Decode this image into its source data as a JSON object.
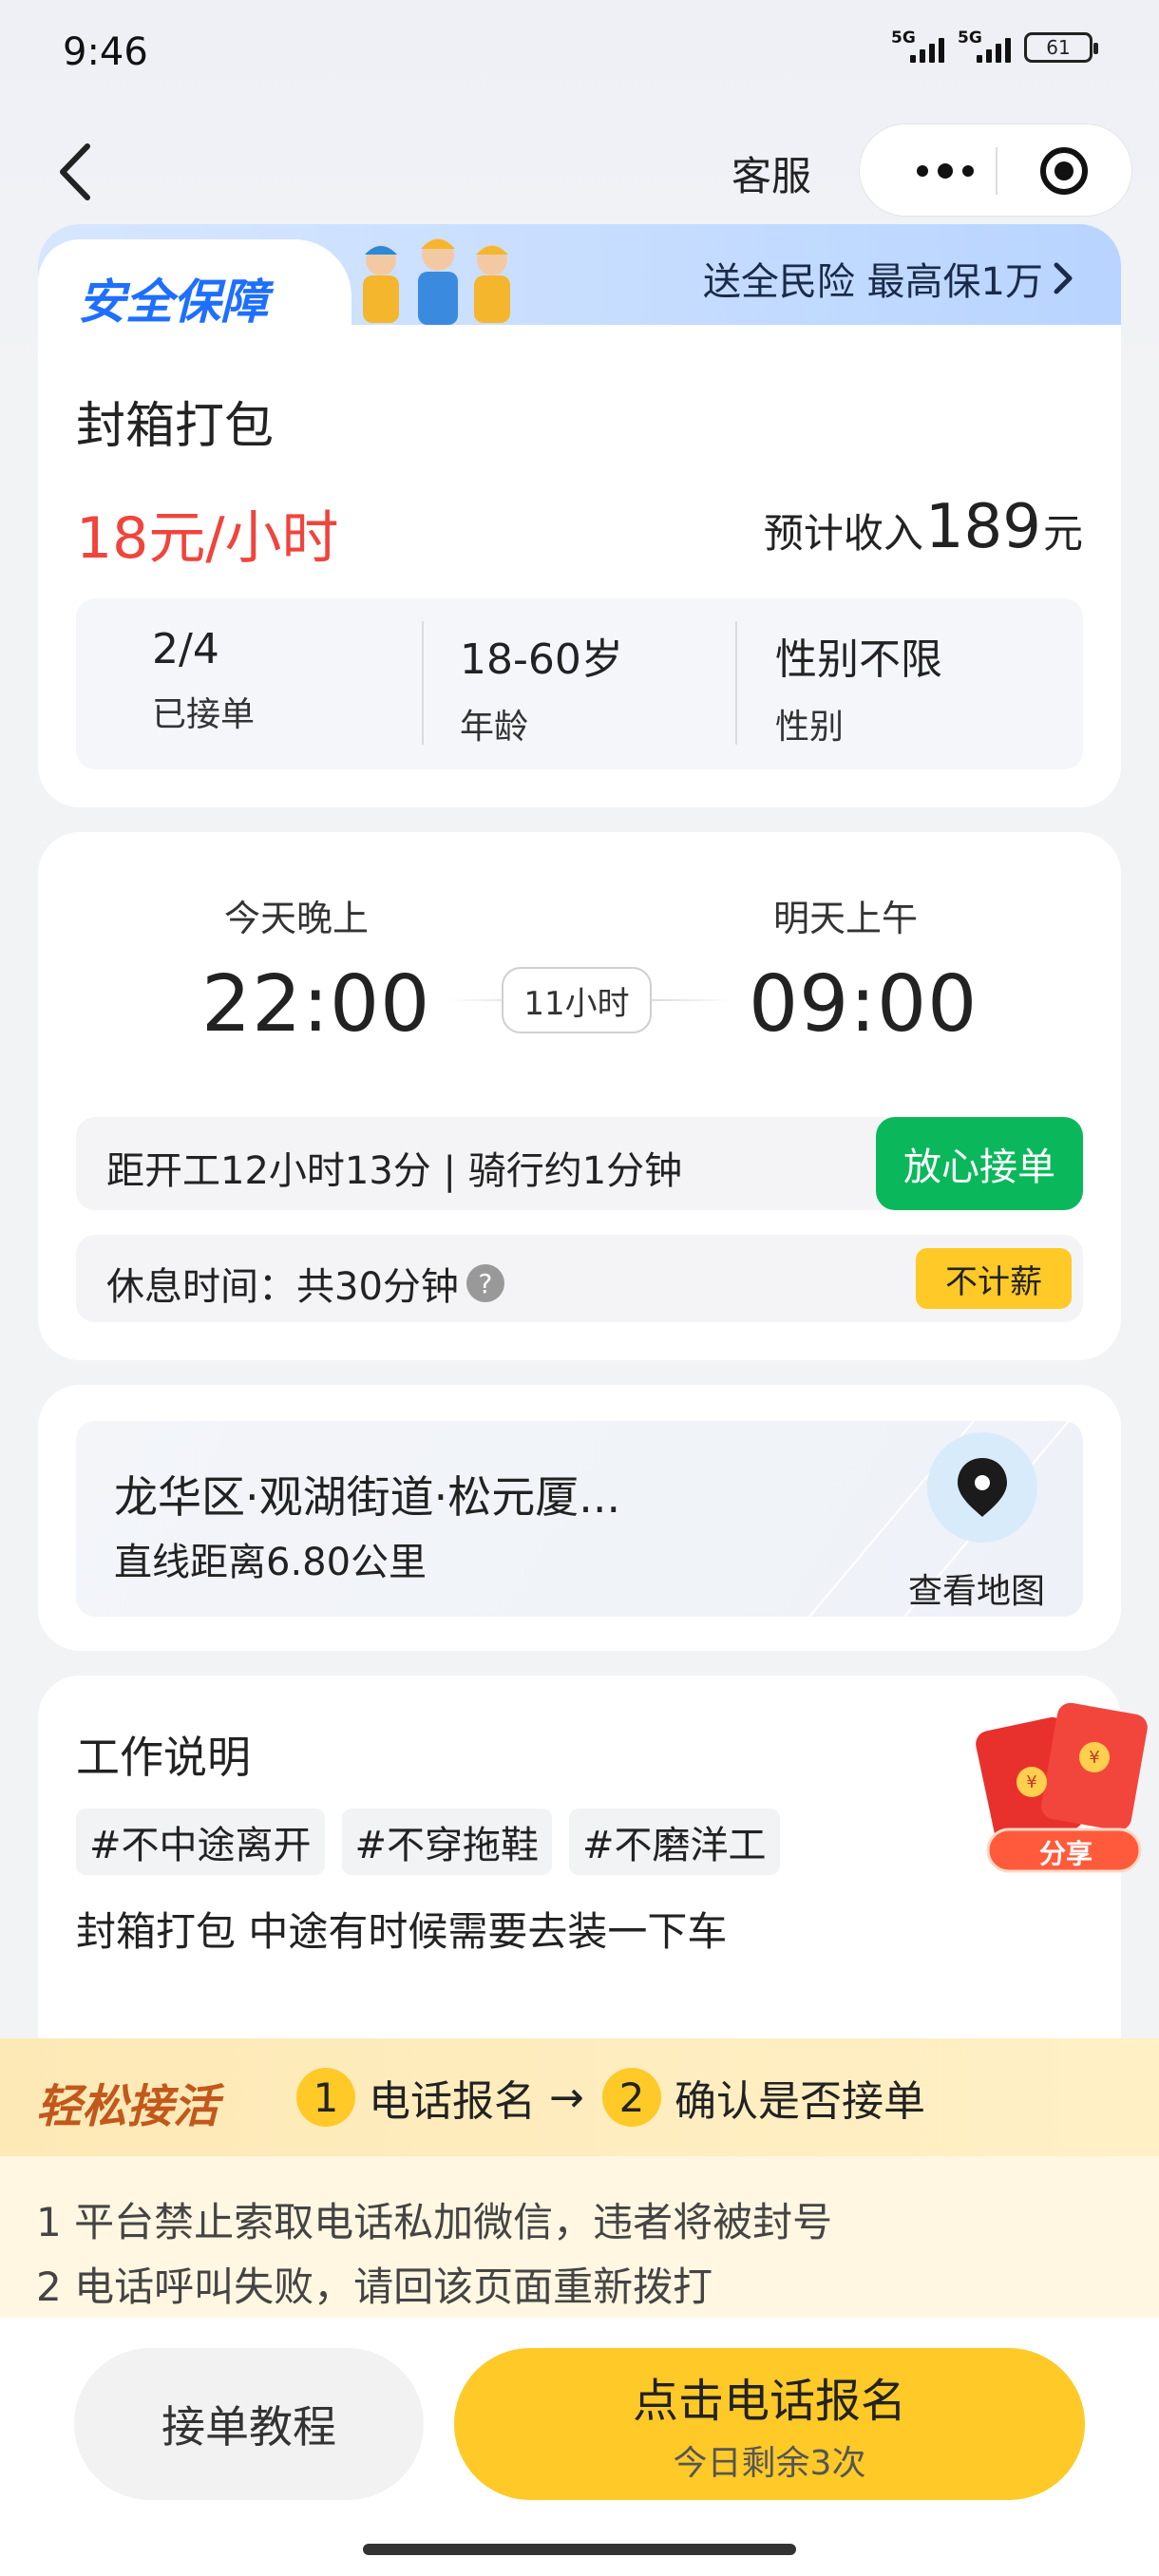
{
  "status_bar": {
    "time": "9:46",
    "signal1": "5G",
    "signal2": "5G",
    "battery": "61"
  },
  "nav": {
    "title": "客服"
  },
  "safety": {
    "title": "安全保障",
    "promo": "送全民险 最高保1万",
    "promo_arrow": "›"
  },
  "job": {
    "title": "封箱打包",
    "wage": "18元/小时",
    "income_prefix": "预计收入",
    "income_value": "189",
    "income_unit": "元",
    "stats": [
      {
        "value": "2/4",
        "label": "已接单"
      },
      {
        "value": "18-60岁",
        "label": "年龄"
      },
      {
        "value": "性别不限",
        "label": "性别"
      }
    ]
  },
  "schedule": {
    "start_label": "今天晚上",
    "start_time": "22:00",
    "duration": "11小时",
    "end_label": "明天上午",
    "end_time": "09:00",
    "distance_text": "距开工12小时13分 | 骑行约1分钟",
    "accept_label": "放心接单",
    "rest_text": "休息时间：共30分钟",
    "help": "?",
    "no_pay": "不计薪"
  },
  "location": {
    "address": "龙华区·观湖街道·松元厦...",
    "distance": "直线距离6.80公里",
    "map_label": "查看地图"
  },
  "description": {
    "title": "工作说明",
    "tags": [
      "#不中途离开",
      "#不穿拖鞋",
      "#不磨洋工"
    ],
    "text": "封箱打包 中途有时候需要去装一下车"
  },
  "redpack": {
    "label": "分享"
  },
  "process": {
    "title": "轻松接活",
    "step1_num": "1",
    "step1": "电话报名",
    "arrow": "→",
    "step2_num": "2",
    "step2": "确认是否接单"
  },
  "notes": [
    "1 平台禁止索取电话私加微信，违者将被封号",
    "2 电话呼叫失败，请回该页面重新拨打"
  ],
  "actions": {
    "tutorial": "接单教程",
    "call": "点击电话报名",
    "call_sub": "今日剩余3次"
  },
  "colors": {
    "wage_red": "#f0443c",
    "accept_green": "#0ab85b",
    "accent_yellow": "#ffc927",
    "safety_blue": "#1e6fff"
  }
}
